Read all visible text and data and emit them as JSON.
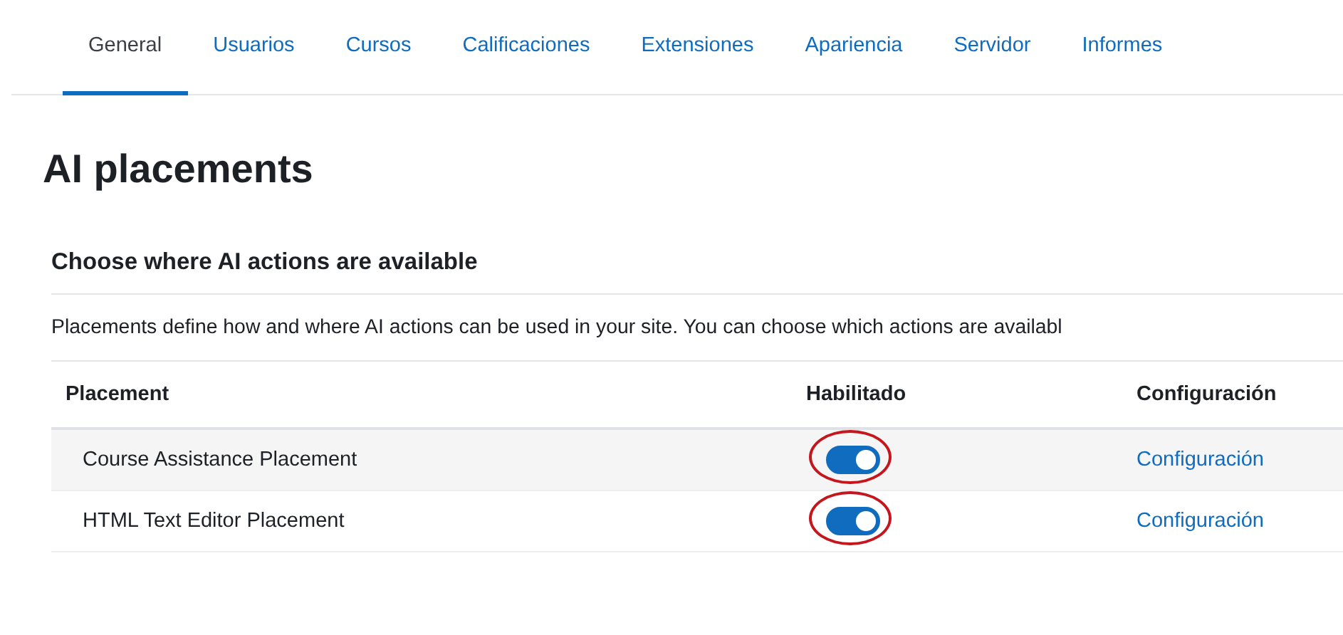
{
  "tabs": [
    {
      "label": "General",
      "selected": true
    },
    {
      "label": "Usuarios",
      "selected": false
    },
    {
      "label": "Cursos",
      "selected": false
    },
    {
      "label": "Calificaciones",
      "selected": false
    },
    {
      "label": "Extensiones",
      "selected": false
    },
    {
      "label": "Apariencia",
      "selected": false
    },
    {
      "label": "Servidor",
      "selected": false
    },
    {
      "label": "Informes",
      "selected": false
    }
  ],
  "title": "AI placements",
  "section": {
    "heading": "Choose where AI actions are available",
    "description": "Placements define how and where AI actions can be used in your site. You can choose which actions are availabl"
  },
  "table": {
    "columns": [
      "Placement",
      "Habilitado",
      "Configuración"
    ],
    "rows": [
      {
        "placement": "Course Assistance Placement",
        "on": true,
        "circled": true,
        "link": "Configuración"
      },
      {
        "placement": "HTML Text Editor Placement",
        "on": true,
        "circled": true,
        "link": "Configuración"
      }
    ]
  }
}
